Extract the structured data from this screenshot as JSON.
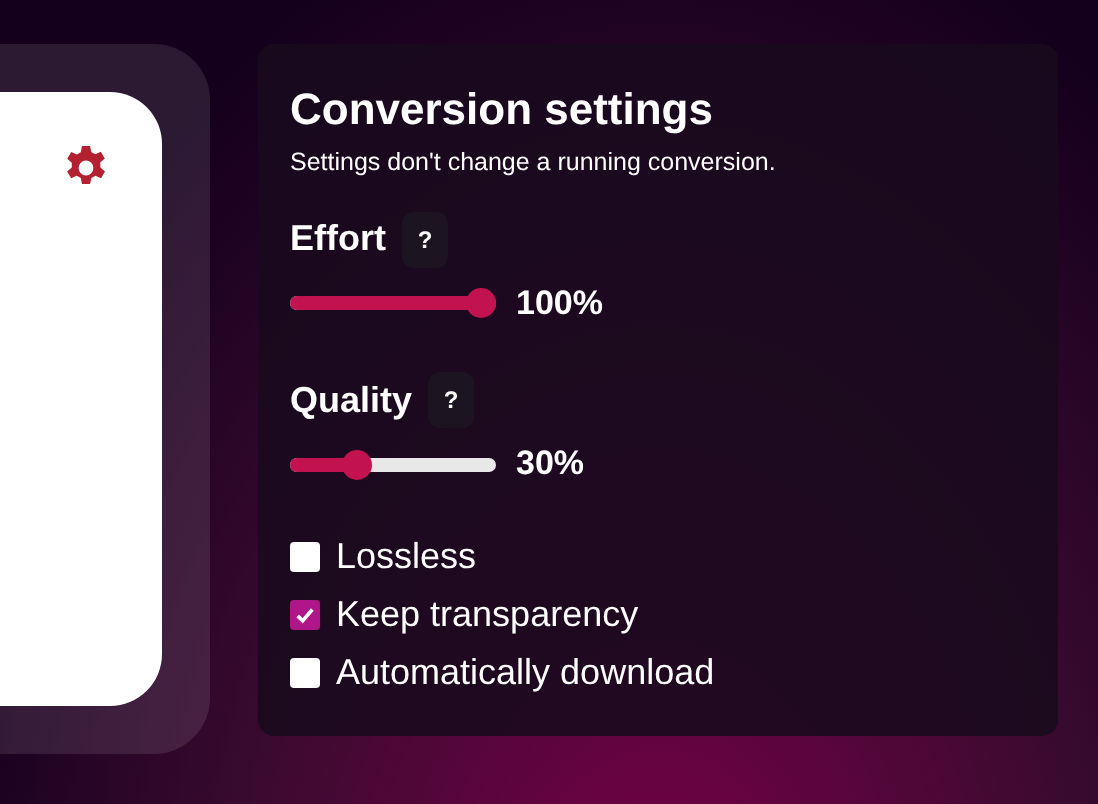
{
  "settings": {
    "title": "Conversion settings",
    "subtitle": "Settings don't change a running conversion.",
    "sliders": [
      {
        "label": "Effort",
        "help": "?",
        "level": 1.0,
        "reading": "100%"
      },
      {
        "label": "Quality",
        "help": "?",
        "level": 0.3,
        "reading": "30%"
      }
    ],
    "options": [
      {
        "label": "Lossless",
        "checked": false
      },
      {
        "label": "Keep transparency",
        "checked": true
      },
      {
        "label": "Automatically download",
        "checked": false
      }
    ]
  }
}
